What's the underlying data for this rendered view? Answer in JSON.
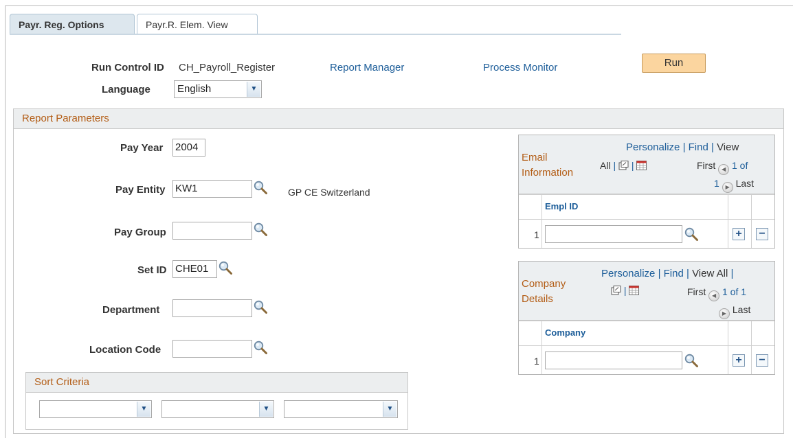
{
  "tabs": [
    {
      "label": "Payr. Reg. Options",
      "active": true
    },
    {
      "label": "Payr.R. Elem. View",
      "active": false
    }
  ],
  "header": {
    "run_control_label": "Run Control ID",
    "run_control_value": "CH_Payroll_Register",
    "report_manager_link": "Report Manager",
    "process_monitor_link": "Process Monitor",
    "run_button": "Run",
    "language_label": "Language",
    "language_value": "English"
  },
  "report_parameters": {
    "title": "Report Parameters",
    "pay_year_label": "Pay Year",
    "pay_year_value": "2004",
    "pay_entity_label": "Pay Entity",
    "pay_entity_value": "KW1",
    "pay_entity_desc": "GP CE Switzerland",
    "pay_group_label": "Pay Group",
    "pay_group_value": "",
    "set_id_label": "Set ID",
    "set_id_value": "CHE01",
    "department_label": "Department",
    "department_value": "",
    "location_code_label": "Location Code",
    "location_code_value": ""
  },
  "sort_criteria": {
    "title": "Sort Criteria",
    "selects": [
      "",
      "",
      ""
    ]
  },
  "email_grid": {
    "title_line1": "Email",
    "title_line2": "Information",
    "personalize": "Personalize",
    "sep": "|",
    "find": "Find",
    "view": "View",
    "all": "All",
    "first": "First",
    "range": "1 of",
    "range2": "1",
    "last": "Last",
    "column": "Empl ID",
    "row_num": "1",
    "row_value": ""
  },
  "company_grid": {
    "title_line1": "Company",
    "title_line2": "Details",
    "personalize": "Personalize",
    "sep": "|",
    "find": "Find",
    "view_all": "View All",
    "first": "First",
    "range": "1 of 1",
    "last": "Last",
    "column": "Company",
    "row_num": "1",
    "row_value": ""
  },
  "icons": {
    "lookup": "magnifier-icon",
    "dropdown": "chevron-down-icon",
    "zoom": "zoom-grid-icon",
    "download": "download-to-excel-icon",
    "prev": "previous-row-icon",
    "next": "next-row-icon",
    "add": "add-row-icon",
    "delete": "delete-row-icon"
  },
  "colors": {
    "link": "#1c5d99",
    "section_title": "#b35d16",
    "run_button": "#fbd59f"
  }
}
